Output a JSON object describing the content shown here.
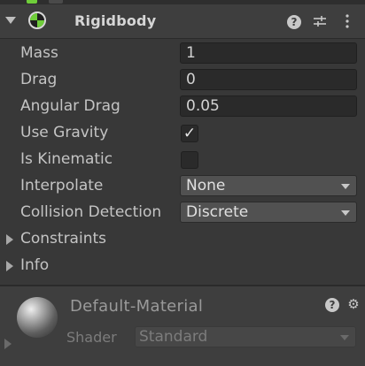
{
  "component": {
    "title": "Rigidbody",
    "icons": [
      "fold-down-icon",
      "rigidbody-icon",
      "help-icon",
      "presets-icon",
      "more-vertical-icon"
    ]
  },
  "fields": {
    "mass": {
      "label": "Mass",
      "value": "1"
    },
    "drag": {
      "label": "Drag",
      "value": "0"
    },
    "angular_drag": {
      "label": "Angular Drag",
      "value": "0.05"
    },
    "use_gravity": {
      "label": "Use Gravity",
      "checked": true,
      "glyph": "✓"
    },
    "is_kinematic": {
      "label": "Is Kinematic",
      "checked": false
    },
    "interpolate": {
      "label": "Interpolate",
      "value": "None"
    },
    "collision_detection": {
      "label": "Collision Detection",
      "value": "Discrete"
    }
  },
  "sections": {
    "constraints": "Constraints",
    "info": "Info"
  },
  "material": {
    "name": "Default-Material",
    "shader_label": "Shader",
    "shader_value": "Standard"
  },
  "colors": {
    "accent_green": "#6fce3a",
    "background": "#383838",
    "field_bg": "#2a2a2a"
  }
}
